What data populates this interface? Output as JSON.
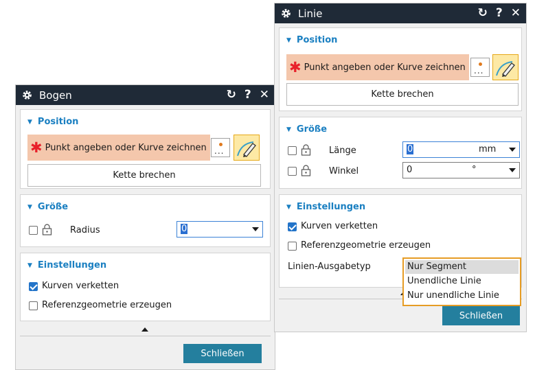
{
  "bogen": {
    "title": "Bogen",
    "position_header": "Position",
    "select_label": "Punkt angeben oder Kurve zeichnen",
    "break_chain_button": "Kette brechen",
    "size_header": "Größe",
    "radius_label": "Radius",
    "radius_value": "0",
    "settings_header": "Einstellungen",
    "chain_curves_label": "Kurven verketten",
    "chain_curves_checked": true,
    "ref_geometry_label": "Referenzgeometrie erzeugen",
    "ref_geometry_checked": false,
    "close_button": "Schließen"
  },
  "linie": {
    "title": "Linie",
    "position_header": "Position",
    "select_label": "Punkt angeben oder Kurve zeichnen",
    "break_chain_button": "Kette brechen",
    "size_header": "Größe",
    "length_label": "Länge",
    "length_value": "0",
    "length_unit": "mm",
    "angle_label": "Winkel",
    "angle_value": "0",
    "angle_unit": "°",
    "settings_header": "Einstellungen",
    "chain_curves_label": "Kurven verketten",
    "chain_curves_checked": true,
    "ref_geometry_label": "Referenzgeometrie erzeugen",
    "ref_geometry_checked": false,
    "output_type_label": "Linien-Ausgabetyp",
    "output_type_options": [
      "Nur Segment",
      "Unendliche Linie",
      "Nur unendliche Linie"
    ],
    "output_type_selected": "Nur Segment",
    "close_button": "Schließen"
  },
  "titlebar_buttons": {
    "reset": "↻",
    "help": "?",
    "close": "✕"
  },
  "colors": {
    "titlebar": "#1f2a37",
    "section_header": "#1a7fc1",
    "selection_highlight": "#f4c7ac",
    "close_button": "#247f9e",
    "dropdown_border": "#e69c24"
  }
}
